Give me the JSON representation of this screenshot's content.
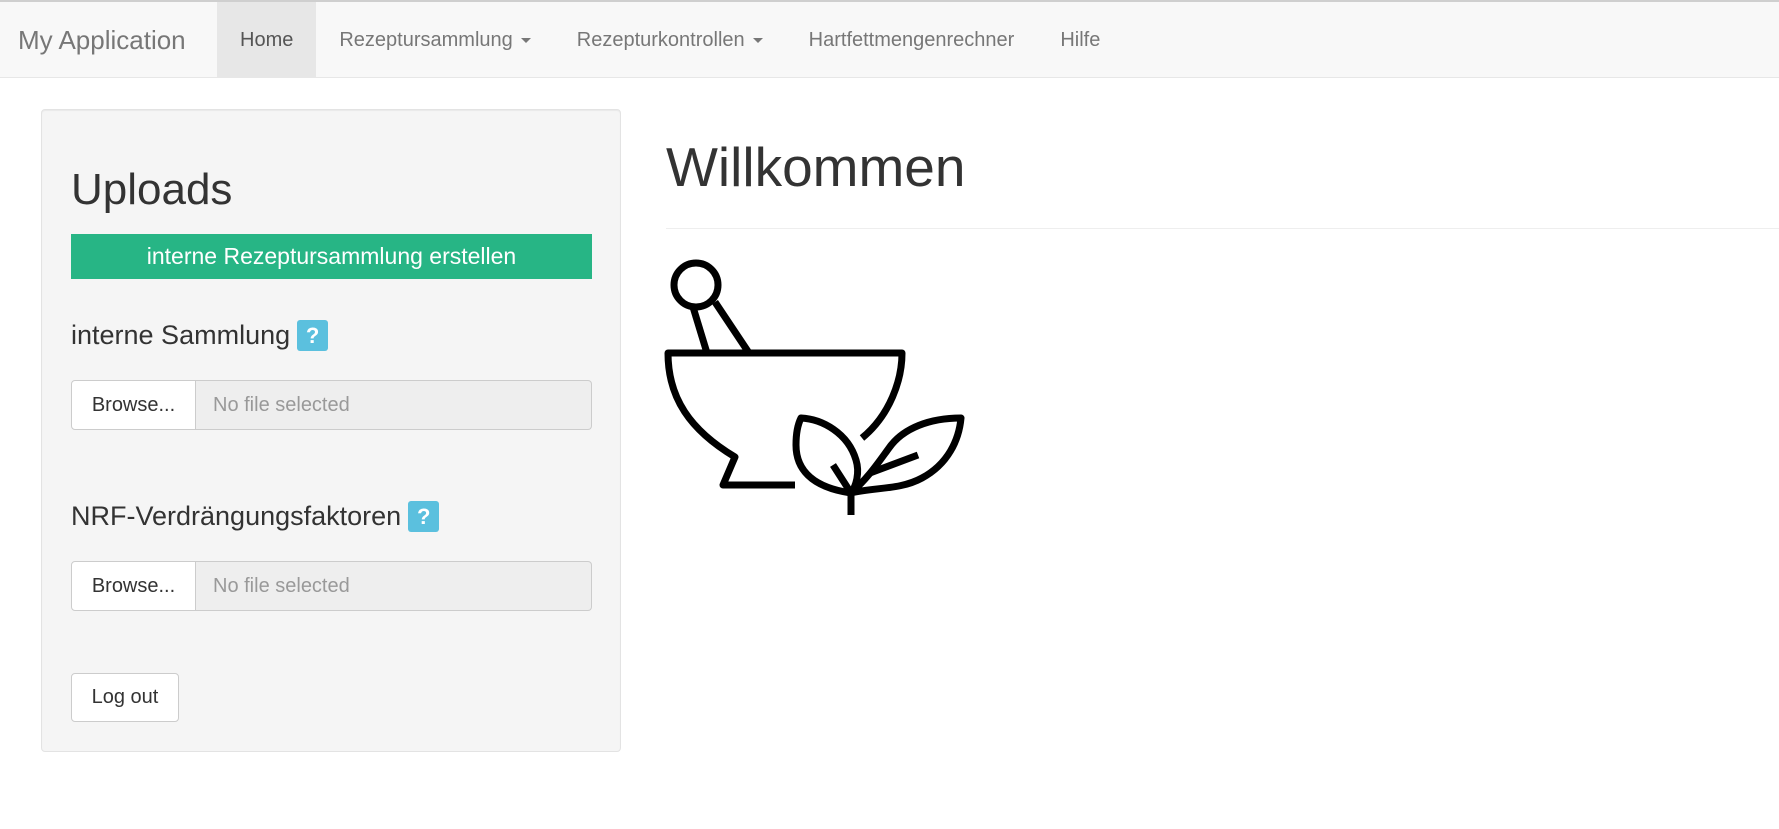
{
  "navbar": {
    "brand": "My Application",
    "items": [
      {
        "label": "Home",
        "active": true,
        "dropdown": false
      },
      {
        "label": "Rezeptursammlung",
        "active": false,
        "dropdown": true
      },
      {
        "label": "Rezepturkontrollen",
        "active": false,
        "dropdown": true
      },
      {
        "label": "Hartfettmengenrechner",
        "active": false,
        "dropdown": false
      },
      {
        "label": "Hilfe",
        "active": false,
        "dropdown": false
      }
    ]
  },
  "sidebar": {
    "title": "Uploads",
    "create_button": "interne Rezeptursammlung erstellen",
    "create_button_color": "#27b585",
    "uploads": [
      {
        "label": "interne Sammlung",
        "help": "?",
        "browse_label": "Browse...",
        "file_placeholder": "No file selected"
      },
      {
        "label": "NRF-Verdrängungsfaktoren",
        "help": "?",
        "browse_label": "Browse...",
        "file_placeholder": "No file selected"
      }
    ],
    "logout_button": "Log out"
  },
  "main": {
    "title": "Willkommen",
    "hero_icon": "mortar-pestle-herbs-icon"
  },
  "colors": {
    "help_badge": "#5bc0de",
    "navbar_bg": "#f8f8f8",
    "nav_active_bg": "#e7e7e7"
  }
}
